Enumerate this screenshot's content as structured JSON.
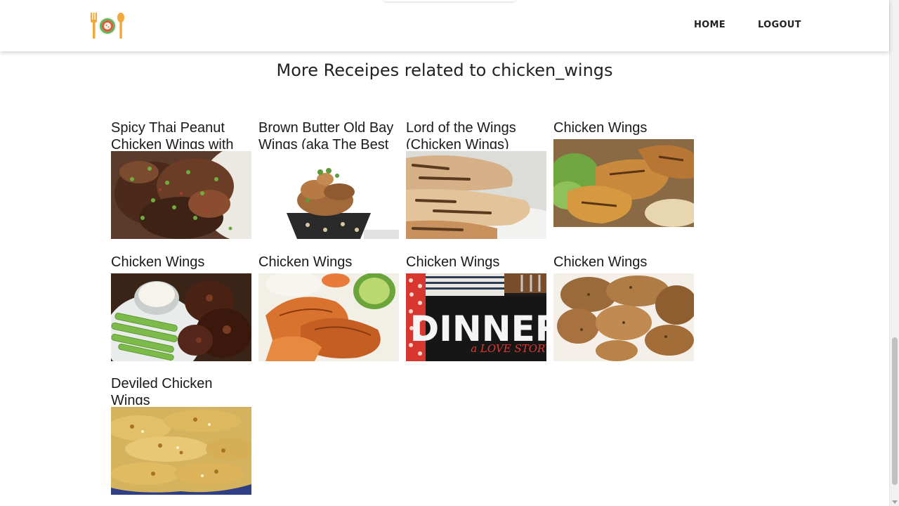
{
  "nav": {
    "logo": "restaurant-plate-icon",
    "home_label": "HOME",
    "logout_label": "LOGOUT"
  },
  "heading": "More Receipes related to chicken_wings",
  "recipes": [
    {
      "title": "Spicy Thai Peanut Chicken Wings with",
      "image": "wings-glazed-scallions"
    },
    {
      "title": "Brown Butter Old Bay Wings (aka The Best",
      "image": "wings-in-bowl"
    },
    {
      "title": "Lord of the Wings (Chicken Wings)",
      "image": "grilled-chicken"
    },
    {
      "title": "Chicken Wings",
      "image": "roasted-wings-lettuce"
    },
    {
      "title": "Chicken Wings",
      "image": "bbq-wings-celery-dip"
    },
    {
      "title": "Chicken Wings",
      "image": "orange-glazed-wings-lime"
    },
    {
      "title": "Chicken Wings",
      "image": "dinner-a-love-story-sign",
      "sign_text": "DINNER",
      "sign_subtext": "a LOVE STORY"
    },
    {
      "title": "Chicken Wings",
      "image": "spiced-roasted-wings"
    },
    {
      "title": "Deviled Chicken Wings",
      "image": "crumbed-wings-tray"
    }
  ],
  "colors": {
    "nav_text": "#222222",
    "heading_text": "#222222",
    "logo_orange": "#f2a93b",
    "logo_green": "#5fb760",
    "logo_red": "#e8593b"
  }
}
